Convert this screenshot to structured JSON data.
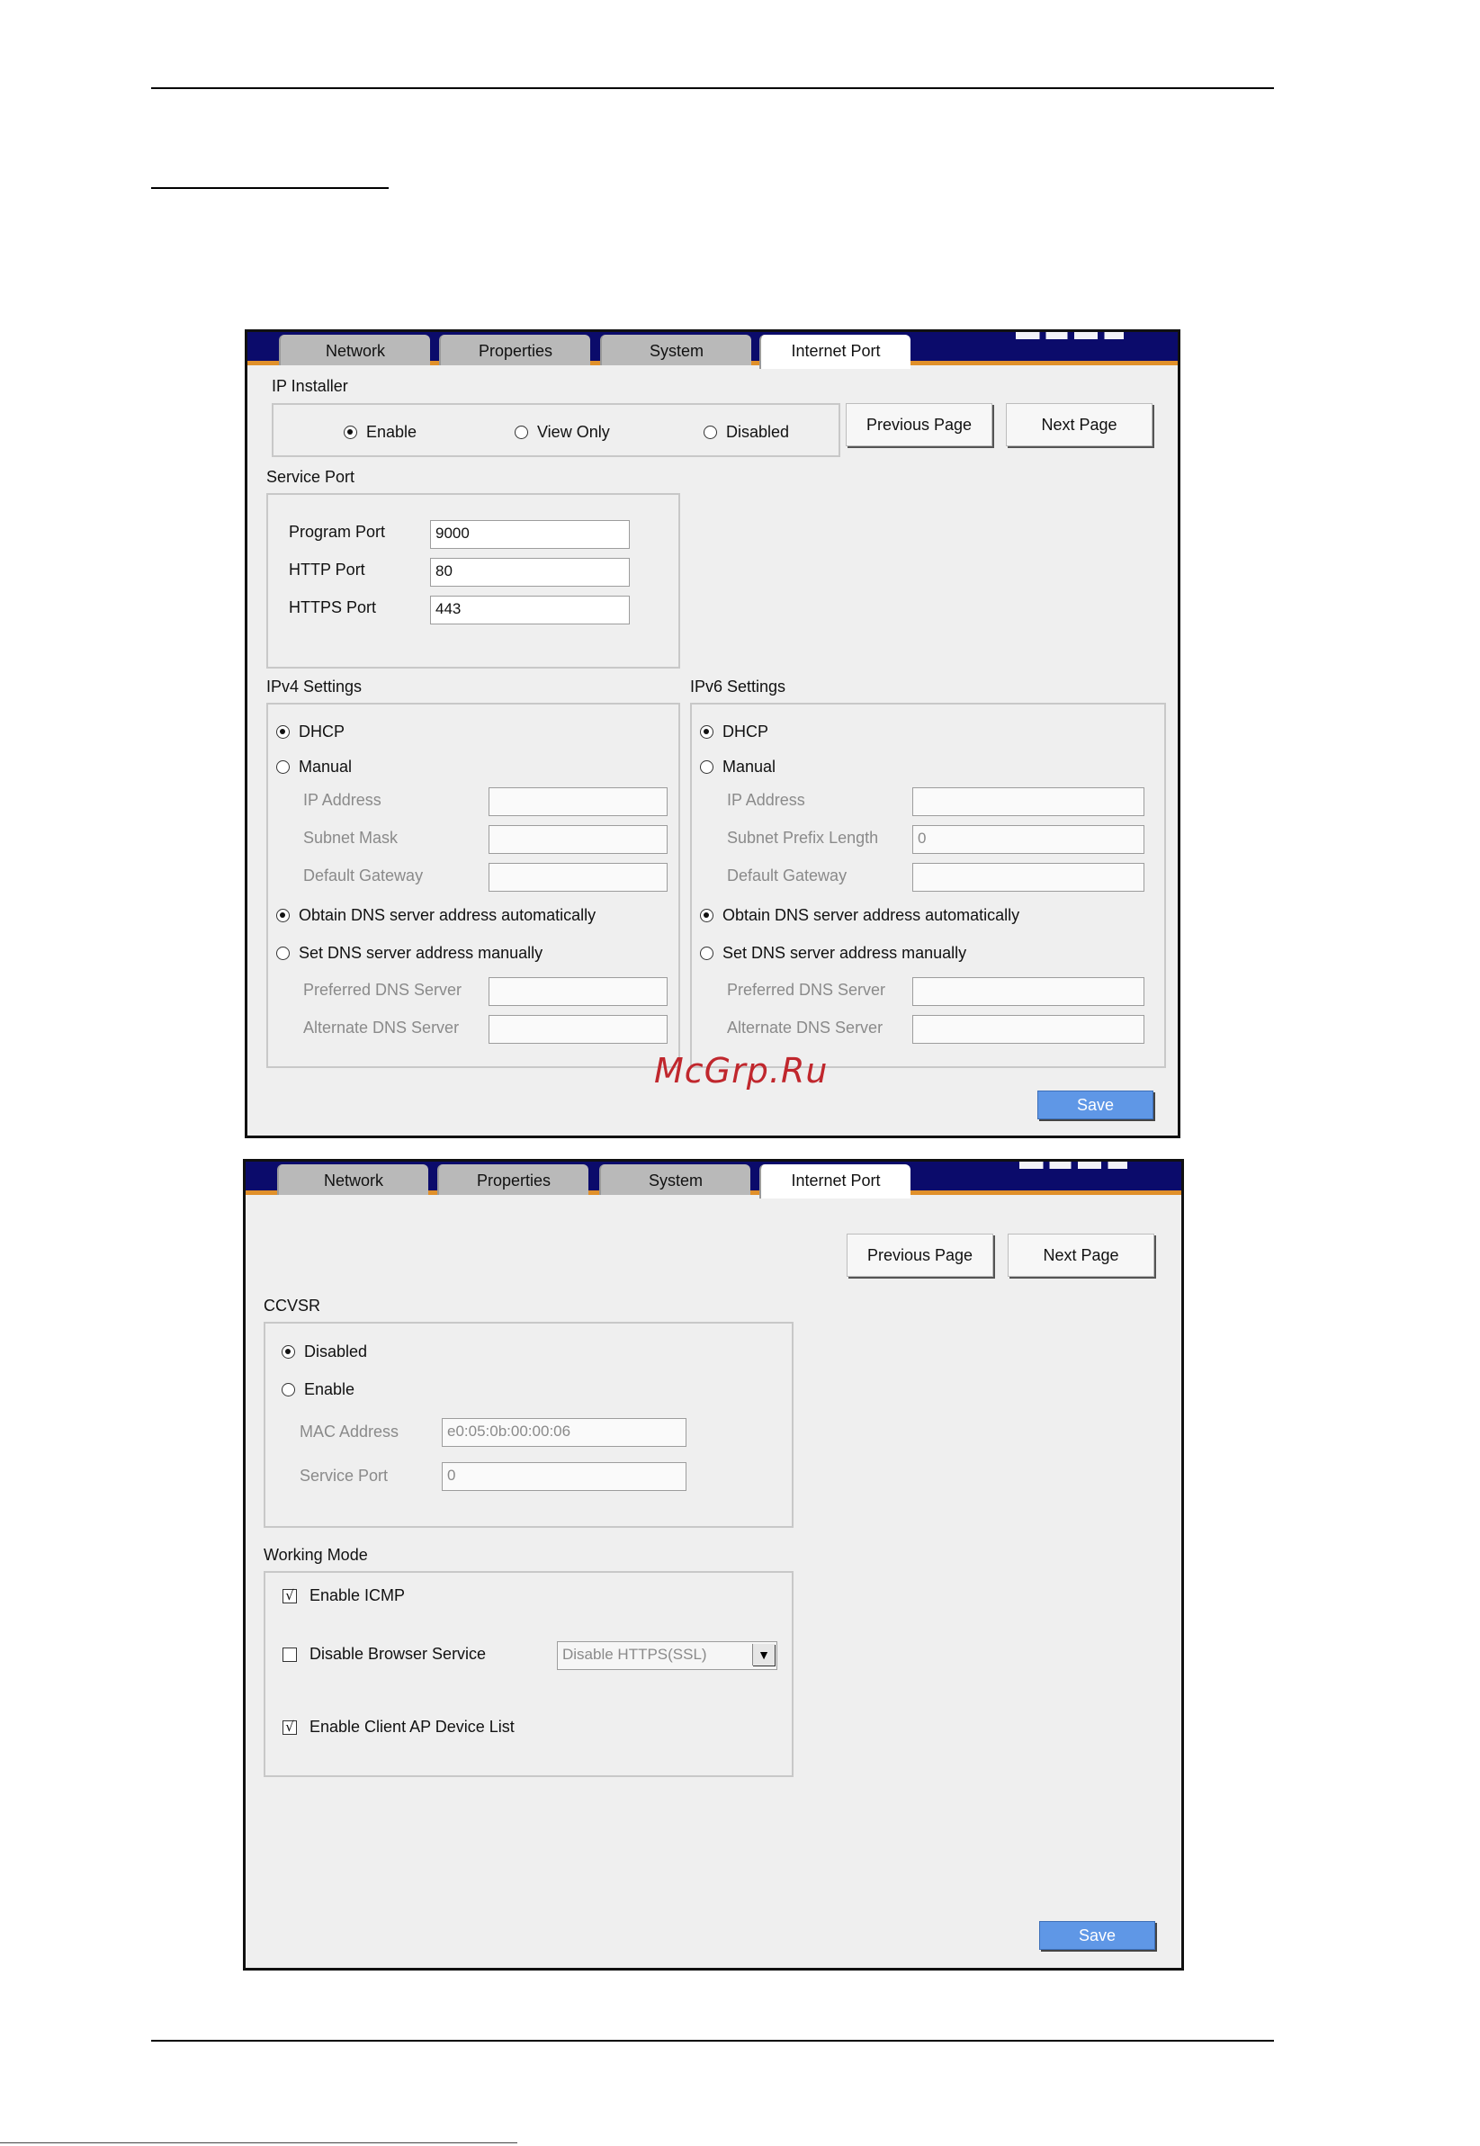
{
  "watermark": "McGrp.Ru",
  "footer_text": "",
  "tabs": [
    "Network",
    "Properties",
    "System",
    "Internet Port"
  ],
  "active_tab": "Internet Port",
  "nav": {
    "previous": "Previous Page",
    "next": "Next Page",
    "save": "Save"
  },
  "page1": {
    "ip_installer": {
      "title": "IP Installer",
      "options": [
        "Enable",
        "View Only",
        "Disabled"
      ],
      "selected": "Enable"
    },
    "service_port": {
      "title": "Service Port",
      "program_port_label": "Program Port",
      "program_port_value": "9000",
      "http_port_label": "HTTP Port",
      "http_port_value": "80",
      "https_port_label": "HTTPS Port",
      "https_port_value": "443"
    },
    "ipv4": {
      "title": "IPv4 Settings",
      "dhcp": "DHCP",
      "manual": "Manual",
      "ip_address": "IP Address",
      "subnet_mask": "Subnet Mask",
      "default_gateway": "Default Gateway",
      "dns_auto": "Obtain DNS server address automatically",
      "dns_manual": "Set DNS server address manually",
      "preferred_dns": "Preferred DNS Server",
      "alternate_dns": "Alternate DNS Server"
    },
    "ipv6": {
      "title": "IPv6 Settings",
      "dhcp": "DHCP",
      "manual": "Manual",
      "ip_address": "IP Address",
      "subnet_prefix_length": "Subnet Prefix Length",
      "subnet_prefix_value": "0",
      "default_gateway": "Default Gateway",
      "dns_auto": "Obtain DNS server address automatically",
      "dns_manual": "Set DNS server address manually",
      "preferred_dns": "Preferred DNS Server",
      "alternate_dns": "Alternate DNS Server"
    }
  },
  "page2": {
    "ccvsr": {
      "title": "CCVSR",
      "disabled": "Disabled",
      "enable": "Enable",
      "mac_address_label": "MAC Address",
      "mac_address_value": "e0:05:0b:00:00:06",
      "service_port_label": "Service Port",
      "service_port_value": "0"
    },
    "working_mode": {
      "title": "Working Mode",
      "enable_icmp": "Enable ICMP",
      "disable_browser_service": "Disable Browser Service",
      "browser_service_option": "Disable HTTPS(SSL)",
      "enable_client_ap": "Enable Client AP Device List",
      "check_mark": "√"
    }
  }
}
